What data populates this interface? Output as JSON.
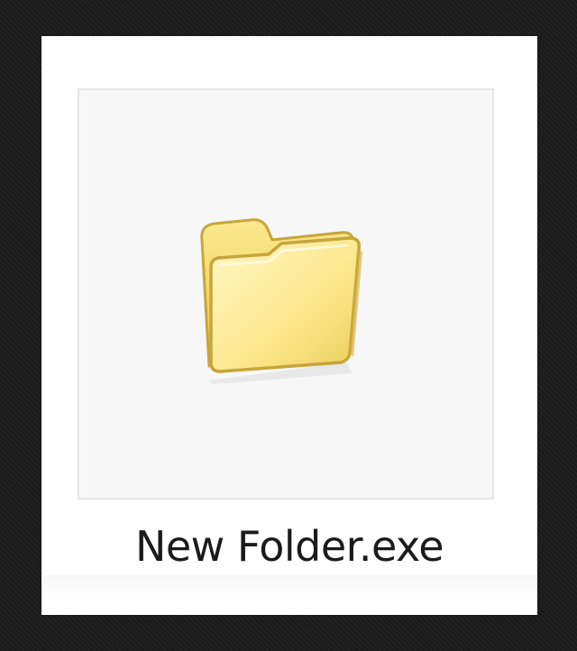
{
  "item": {
    "label": "New Folder.exe",
    "icon": "folder-icon",
    "selected": false
  },
  "colors": {
    "folder_fill_light": "#fff6b0",
    "folder_fill_dark": "#f0d860",
    "folder_outline": "#c9a93a",
    "tile_background": "#f7f7f8",
    "tile_border": "#e6e6e8",
    "outer_background": "#1c1c1c"
  }
}
